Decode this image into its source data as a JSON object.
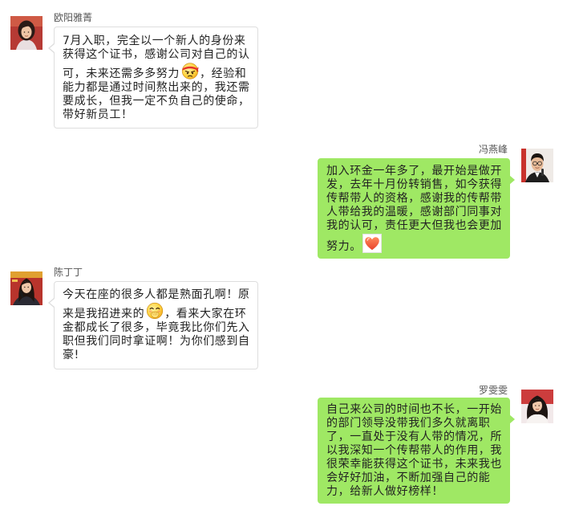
{
  "chat": {
    "messages": [
      {
        "sender": "欧阳雅菁",
        "lines": [
          "7月入职，完全以一个新人的身份来",
          "获得这个证书，感谢公司对自己的认",
          {
            "before": "可，未来还需多多努力",
            "emoji": "fighting-face-icon",
            "after": "，经验和"
          },
          "能力都是通过时间熬出来的，我还需",
          "要成长，但我一定不负自己的使命，",
          "带好新员工！"
        ]
      },
      {
        "sender": "冯燕峰",
        "lines": [
          "加入环金一年多了，最开始是做开",
          "发，去年十月份转销售，如今获得",
          "传帮带人的资格，感谢我的传帮带",
          "人带给我的温暖，感谢部门同事对",
          "我的认可，责任更大但我也会更加",
          {
            "before": "努力。",
            "emoji": "heart-icon"
          }
        ]
      },
      {
        "sender": "陈丁丁",
        "lines": [
          "今天在座的很多人都是熟面孔啊！原",
          {
            "before": "来是我招进来的",
            "emoji": "chuckle-face-icon",
            "after": "，看来大家在环"
          },
          "金都成长了很多，毕竟我比你们先入",
          "职但我们同时拿证啊！为你们感到自",
          "豪!"
        ]
      },
      {
        "sender": "罗雯雯",
        "lines": [
          "自己来公司的时间也不长，一开始",
          "的部门领导没带我们多久就离职",
          "了，一直处于没有人带的情况，所",
          "以我深知一个传帮带人的作用，我",
          "很荣幸能获得这个证书，未来我也",
          "会好好加油，不断加强自己的能",
          "力，给新人做好榜样！"
        ]
      }
    ]
  },
  "colors": {
    "page_background": "#ffffff",
    "incoming_bubble": "#ffffff",
    "incoming_border": "#dedede",
    "outgoing_bubble": "#9fe864",
    "sender_name": "#555555",
    "message_text": "#222222"
  }
}
